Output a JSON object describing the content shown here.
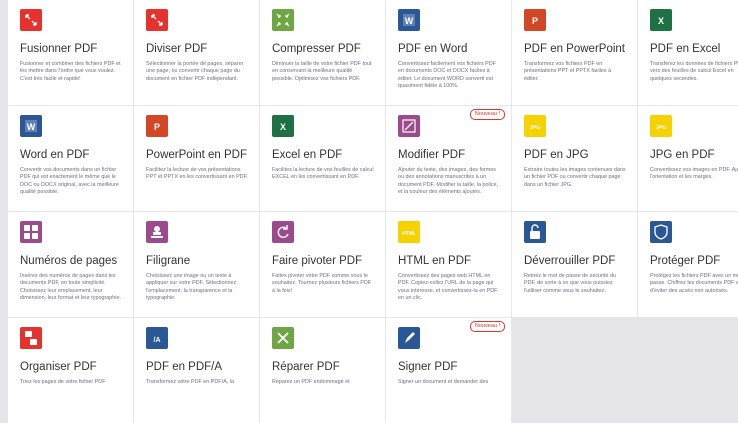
{
  "tools": [
    {
      "name": "merge",
      "icon": "merge-icon",
      "color": "#e5322d",
      "title": "Fusionner PDF",
      "desc": "Fusionner et combiner des fichiers PDF et les mettre dans l'ordre que vous voulez. C'est très facile et rapide!"
    },
    {
      "name": "split",
      "icon": "split-icon",
      "color": "#e5322d",
      "title": "Diviser PDF",
      "desc": "Sélectionner la portée de pages, séparer une page, ou convertir chaque page du document en fichier PDF indépendant."
    },
    {
      "name": "compress",
      "icon": "compress-icon",
      "color": "#6ea644",
      "title": "Compresser PDF",
      "desc": "Diminuer la taille de votre fichier PDF tout en conservant la meilleure qualité possible. Optimisez vos fichiers PDF."
    },
    {
      "name": "pdf-to-word",
      "icon": "word-doc-icon",
      "color": "#2b5797",
      "title": "PDF en Word",
      "desc": "Convertissez facilement vos fichiers PDF en documents DOC et DOCX faciles à éditer. Le document WORD converti est quasiment fidèle à 100%."
    },
    {
      "name": "pdf-to-powerpoint",
      "icon": "powerpoint-doc-icon",
      "color": "#d24726",
      "title": "PDF en PowerPoint",
      "desc": "Transformez vos fichiers PDF en présentations PPT et PPTX faciles à éditer."
    },
    {
      "name": "pdf-to-excel",
      "icon": "excel-doc-icon",
      "color": "#1e7145",
      "title": "PDF en Excel",
      "desc": "Transférez les données de fichiers PDF vers des feuilles de calcul Excel en quelques secondes."
    },
    {
      "name": "word-to-pdf",
      "icon": "word-doc-icon",
      "color": "#2b5797",
      "title": "Word en PDF",
      "desc": "Convertir vos documents dans un fichier PDF qui est exactement le même que le DOC ou DOCX original, avec la meilleure qualité possible."
    },
    {
      "name": "powerpoint-to-pdf",
      "icon": "powerpoint-doc-icon",
      "color": "#d24726",
      "title": "PowerPoint en PDF",
      "desc": "Facilitez la lecture de vos présentations PPT et PPTX en les convertissant en PDF."
    },
    {
      "name": "excel-to-pdf",
      "icon": "excel-doc-icon",
      "color": "#1e7145",
      "title": "Excel en PDF",
      "desc": "Facilitez la lecture de vos feuilles de calcul EXCEL en les convertissant en PDF."
    },
    {
      "name": "edit-pdf",
      "icon": "edit-icon",
      "color": "#9c4a8e",
      "title": "Modifier PDF",
      "desc": "Ajouter du texte, des images, des formes ou des annotations manuscrites à un document PDF. Modifier la taille, la police, et la couleur des éléments ajoutés.",
      "badge": "Nouveau !"
    },
    {
      "name": "pdf-to-jpg",
      "icon": "jpg-image-icon",
      "color": "#f5d200",
      "title": "PDF en JPG",
      "desc": "Extraire toutes les images contenues dans un fichier PDF ou convertir chaque page dans un fichier JPG."
    },
    {
      "name": "jpg-to-pdf",
      "icon": "jpg-image-icon",
      "color": "#f5d200",
      "title": "JPG en PDF",
      "desc": "Convertissez vos images en PDF. Ajustez l'orientation et les marges."
    },
    {
      "name": "page-numbers",
      "icon": "page-numbers-icon",
      "color": "#9c4a8e",
      "title": "Numéros de pages",
      "desc": "Insérez des numéros de pages dans les documents PDF, en toute simplicité. Choisissez leur emplacement, leur dimension, leur format et leur typographie."
    },
    {
      "name": "watermark",
      "icon": "stamp-icon",
      "color": "#9c4a8e",
      "title": "Filigrane",
      "desc": "Choisissez une image ou un texte à appliquer sur votre PDF. Sélectionnez l'emplacement, la transparence et la typographie."
    },
    {
      "name": "rotate",
      "icon": "rotate-icon",
      "color": "#9c4a8e",
      "title": "Faire pivoter PDF",
      "desc": "Faites pivoter votre PDF comme vous le souhaitez. Tournez plusieurs fichiers PDF à la fois!"
    },
    {
      "name": "html-to-pdf",
      "icon": "html-icon",
      "color": "#f5d200",
      "title": "HTML en PDF",
      "desc": "Convertissez des pages web HTML en PDF. Copiez-collez l'URL de la page qui vous intéresse, et convertissez-la en PDF en un clic."
    },
    {
      "name": "unlock",
      "icon": "unlock-icon",
      "color": "#2b5797",
      "title": "Déverrouiller PDF",
      "desc": "Retirez le mot de passe de sécurité du PDF, de sorte à ce que vous puissiez l'utiliser comme vous le souhaitez."
    },
    {
      "name": "protect",
      "icon": "shield-icon",
      "color": "#2b5797",
      "title": "Protéger PDF",
      "desc": "Protégez les fichiers PDF avec un mot de passe. Chiffrez les documents PDF afin d'éviter des accès non autorisés."
    },
    {
      "name": "organize",
      "icon": "organize-icon",
      "color": "#e5322d",
      "title": "Organiser PDF",
      "desc": "Triez les pages de votre fichier PDF"
    },
    {
      "name": "pdf-to-pdfa",
      "icon": "pdfa-icon",
      "color": "#2b5797",
      "title": "PDF en PDF/A",
      "desc": "Transformez votre PDF en PDF/A, la"
    },
    {
      "name": "repair",
      "icon": "repair-icon",
      "color": "#6ea644",
      "title": "Réparer PDF",
      "desc": "Réparez un PDF endommagé et"
    },
    {
      "name": "sign",
      "icon": "sign-icon",
      "color": "#2b5797",
      "title": "Signer PDF",
      "desc": "Signer un document et demander des",
      "badge": "Nouveau !"
    }
  ]
}
